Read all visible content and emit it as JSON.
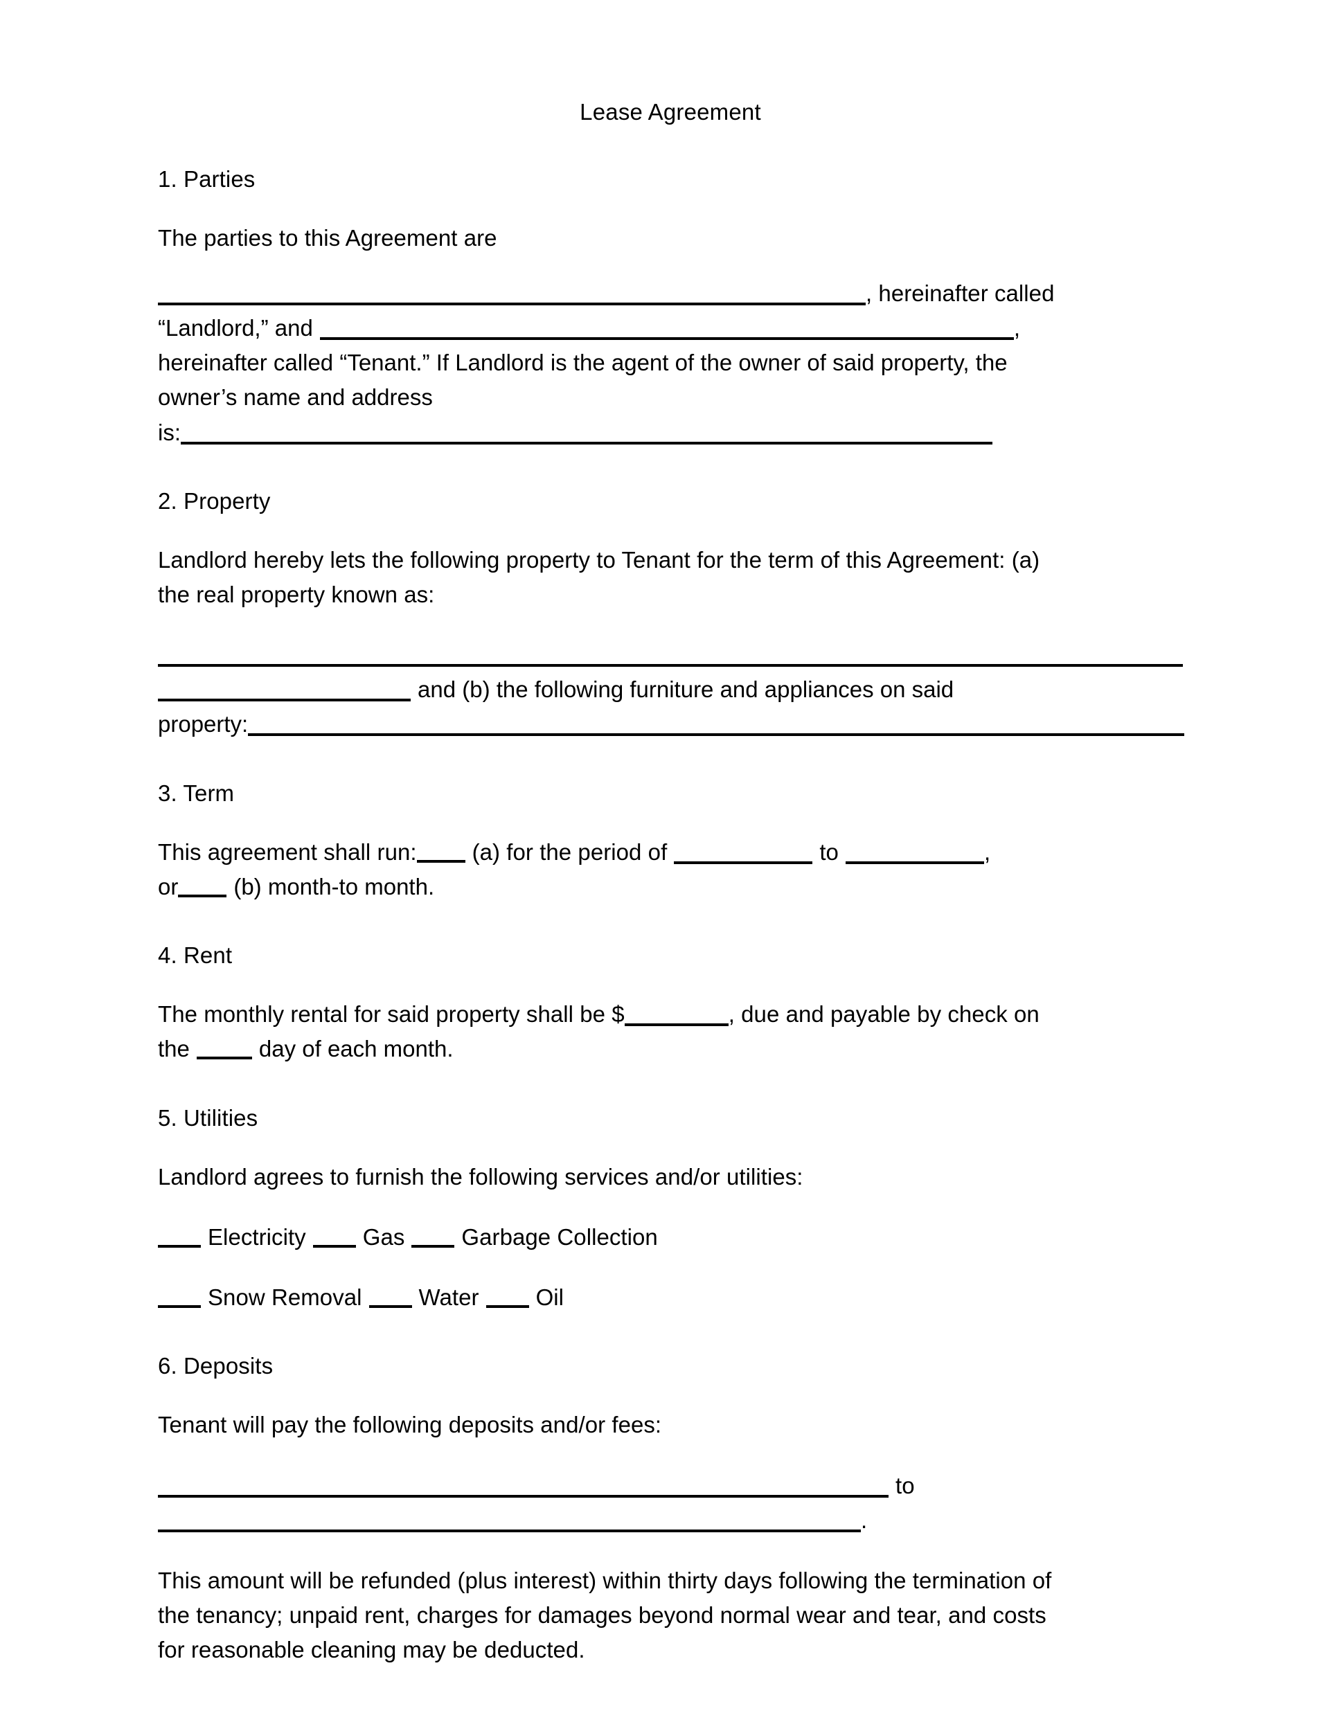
{
  "document": {
    "title": "Lease Agreement"
  },
  "sections": [
    {
      "id": "parties",
      "heading": "1. Parties",
      "intro": "The parties to this Agreement are",
      "line_after_first_blank": ", hereinafter called",
      "landlord_label": "“Landlord,” and",
      "landlord_trailing_comma": ",",
      "tenant_sentence": "hereinafter called “Tenant.” If Landlord is the agent of the owner of said property, the",
      "owner_line": "owner’s name and address",
      "is_label": "is:"
    },
    {
      "id": "property",
      "heading": "2. Property",
      "para_line1": "Landlord hereby lets the following property to Tenant for the term of this Agreement: (a)",
      "para_line2": "the real property known as:",
      "furniture_text": "and (b) the following furniture and appliances on said",
      "property_label": "property:"
    },
    {
      "id": "term",
      "heading": "3. Term",
      "run_prefix": "This agreement shall run:",
      "option_a": "(a) for the period of",
      "to_word": "to",
      "comma": ",",
      "or_word": "or",
      "option_b": "(b) month-to month."
    },
    {
      "id": "rent",
      "heading": "4. Rent",
      "rent_prefix": "The monthly rental for said property shall be $",
      "rent_suffix": ", due and payable by check on",
      "day_prefix": "the",
      "day_suffix": "day of each month."
    },
    {
      "id": "utilities",
      "heading": "5. Utilities",
      "intro": "Landlord agrees to furnish the following services and/or utilities:",
      "row1": [
        "Electricity",
        "Gas",
        "Garbage Collection"
      ],
      "row2": [
        "Snow Removal",
        "Water",
        "Oil"
      ]
    },
    {
      "id": "deposits",
      "heading": "6. Deposits",
      "intro": "Tenant will pay the following deposits and/or fees:",
      "to_word": "to",
      "period": ".",
      "refund_line1": "This amount will be refunded (plus interest) within thirty days following the termination of",
      "refund_line2": "the tenancy; unpaid rent, charges for damages beyond normal wear and tear, and costs",
      "refund_line3": "for reasonable cleaning may be deducted."
    }
  ]
}
